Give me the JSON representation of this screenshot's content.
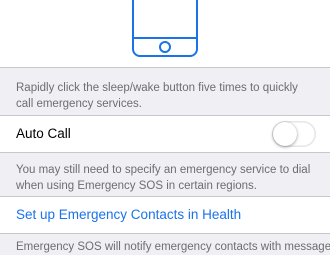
{
  "colors": {
    "background": "#efeff4",
    "cell": "#ffffff",
    "link": "#1a73e8",
    "footnote": "#6d6d72",
    "icon": "#1a73e8"
  },
  "hero": {
    "icon": "iphone-outline-icon"
  },
  "sleep_wake_note": "Rapidly click the sleep/wake button five times to quickly call emergency services.",
  "auto_call": {
    "label": "Auto Call",
    "toggle_on": false
  },
  "auto_call_note": "You may still need to specify an emergency service to dial when using Emergency SOS in certain regions.",
  "contacts": {
    "link_label": "Set up Emergency Contacts in Health"
  },
  "contacts_note": "Emergency SOS will notify emergency contacts with messages"
}
